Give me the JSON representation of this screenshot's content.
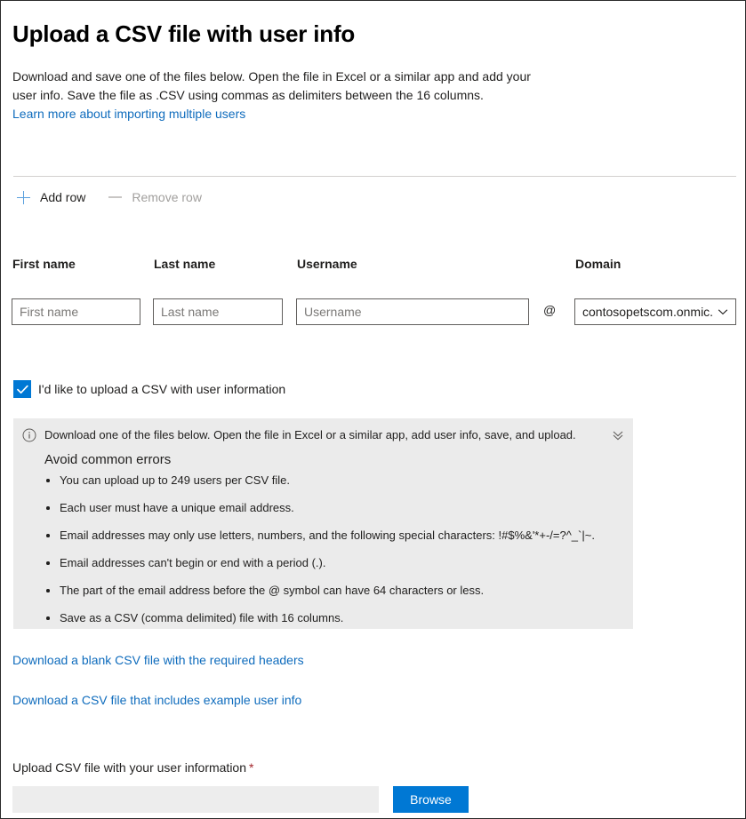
{
  "page": {
    "title": "Upload a CSV file with user info",
    "intro_line1": "Download and save one of the files below. Open the file in Excel or a similar app and add your",
    "intro_line2": "user info. Save the file as .CSV using commas as delimiters between the 16 columns.",
    "intro_link": "Learn more about importing multiple users"
  },
  "command_bar": {
    "add_row": "Add row",
    "remove_row": "Remove row",
    "add_icon": "plus-icon",
    "remove_icon": "minus-icon"
  },
  "user_row": {
    "columns": [
      {
        "label": "First name",
        "placeholder": "First name"
      },
      {
        "label": "Last name",
        "placeholder": "Last name"
      },
      {
        "label": "Username",
        "placeholder": "Username"
      },
      {
        "label": "Domain"
      }
    ],
    "at_symbol": "@",
    "domain_value": "contosopetscom.onmic...",
    "domain_icon": "chevron-down-icon"
  },
  "csv_checkbox": {
    "label": "I'd like to upload a CSV with user information",
    "checked": true
  },
  "info_panel": {
    "icon": "info-icon",
    "collapse_icon": "chevron-double-down-icon",
    "header": "Download one of the files below. Open the file in Excel or a similar app, add user info, save, and upload.",
    "subtitle": "Avoid common errors",
    "bullets": [
      "You can upload up to 249 users per CSV file.",
      "Each user must have a unique email address.",
      "Email addresses may only use letters, numbers, and the following special characters: !#$%&'*+-/=?^_`|~.",
      "Email addresses can't begin or end with a period (.).",
      "The part of the email address before the @ symbol can have 64 characters or less.",
      "Save as a CSV (comma delimited) file with 16 columns."
    ]
  },
  "downloads": {
    "blank_csv": "Download a blank CSV file with the required headers",
    "example_csv": "Download a CSV file that includes example user info"
  },
  "upload": {
    "label": "Upload CSV file with your user information",
    "required_marker": "*",
    "file_value": "",
    "browse_label": "Browse"
  },
  "colors": {
    "accent_blue": "#0078d4",
    "link_blue": "#0f6cbd",
    "plus_blue": "#5aa0de",
    "disabled_gray": "#a19f9d",
    "panel_bg": "#ebebeb",
    "filebox_bg": "#ededed",
    "required_red": "#a4262c"
  }
}
